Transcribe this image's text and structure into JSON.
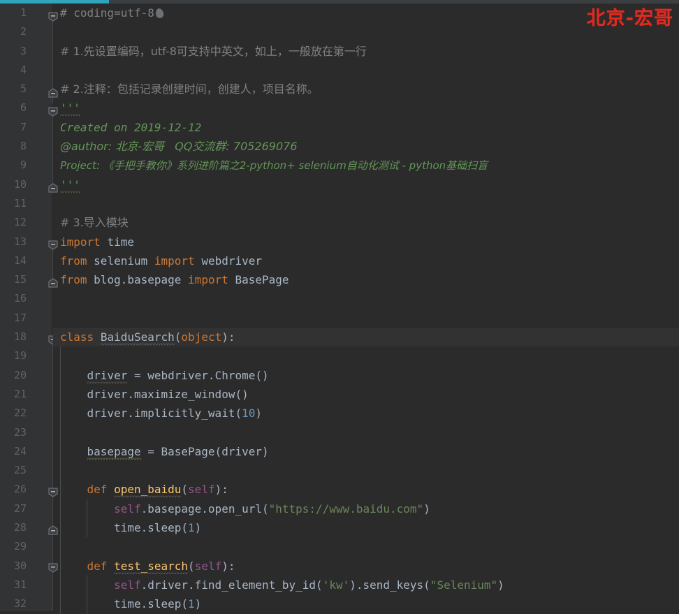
{
  "app": {
    "kind": "code-editor",
    "theme": "darcula",
    "background": "#2b2b2b",
    "highlight_line_bg": "#323232",
    "gutter_bg": "#313335"
  },
  "progress_bar": {
    "color": "#31a4bc",
    "track_color": "#3c3f41",
    "percent": 16
  },
  "watermark": {
    "text": "北京-宏哥",
    "color": "#e02b20"
  },
  "gutter": {
    "line_numbers": [
      1,
      2,
      3,
      4,
      5,
      6,
      7,
      8,
      9,
      10,
      11,
      12,
      13,
      14,
      15,
      16,
      17,
      18,
      19,
      20,
      21,
      22,
      23,
      24,
      25,
      26,
      27,
      28,
      29,
      30,
      31,
      32
    ],
    "fold_markers": [
      {
        "line": 1,
        "state": "expanded"
      },
      {
        "line": 5,
        "state": "collapsed-region"
      },
      {
        "line": 6,
        "state": "expanded"
      },
      {
        "line": 10,
        "state": "collapsed-region"
      },
      {
        "line": 13,
        "state": "expanded"
      },
      {
        "line": 15,
        "state": "collapsed-region"
      },
      {
        "line": 18,
        "state": "expanded"
      },
      {
        "line": 26,
        "state": "expanded"
      },
      {
        "line": 28,
        "state": "collapsed-region"
      },
      {
        "line": 30,
        "state": "expanded"
      }
    ]
  },
  "editor": {
    "highlighted_line": 18,
    "lines": [
      {
        "n": 1,
        "text": "# coding=utf-8"
      },
      {
        "n": 2,
        "text": ""
      },
      {
        "n": 3,
        "text": "# 1.先设置编码，utf-8可支持中英文，如上，一般放在第一行"
      },
      {
        "n": 4,
        "text": ""
      },
      {
        "n": 5,
        "text": "# 2.注释：包括记录创建时间，创建人，项目名称。"
      },
      {
        "n": 6,
        "text": "'''"
      },
      {
        "n": 7,
        "text": "Created on 2019-12-12"
      },
      {
        "n": 8,
        "text": "@author: 北京-宏哥   QQ交流群: 705269076"
      },
      {
        "n": 9,
        "text": "Project: 《手把手教你》系列进阶篇之2-python+ selenium自动化测试 - python基础扫盲"
      },
      {
        "n": 10,
        "text": "'''"
      },
      {
        "n": 11,
        "text": ""
      },
      {
        "n": 12,
        "text": "# 3.导入模块"
      },
      {
        "n": 13,
        "text": "import time"
      },
      {
        "n": 14,
        "text": "from selenium import webdriver"
      },
      {
        "n": 15,
        "text": "from blog.basepage import BasePage"
      },
      {
        "n": 16,
        "text": ""
      },
      {
        "n": 17,
        "text": ""
      },
      {
        "n": 18,
        "text": "class BaiduSearch(object):"
      },
      {
        "n": 19,
        "text": ""
      },
      {
        "n": 20,
        "text": "    driver = webdriver.Chrome()"
      },
      {
        "n": 21,
        "text": "    driver.maximize_window()"
      },
      {
        "n": 22,
        "text": "    driver.implicitly_wait(10)"
      },
      {
        "n": 23,
        "text": ""
      },
      {
        "n": 24,
        "text": "    basepage = BasePage(driver)"
      },
      {
        "n": 25,
        "text": ""
      },
      {
        "n": 26,
        "text": "    def open_baidu(self):"
      },
      {
        "n": 27,
        "text": "        self.basepage.open_url(\"https://www.baidu.com\")"
      },
      {
        "n": 28,
        "text": "        time.sleep(1)"
      },
      {
        "n": 29,
        "text": ""
      },
      {
        "n": 30,
        "text": "    def test_search(self):"
      },
      {
        "n": 31,
        "text": "        self.driver.find_element_by_id('kw').send_keys(\"Selenium\")"
      },
      {
        "n": 32,
        "text": "        time.sleep(1)"
      }
    ],
    "tokens": {
      "line1_comment": "# coding=utf-8",
      "line3_comment": "# 1.先设置编码，utf-8可支持中英文，如上，一般放在第一行",
      "line5_comment": "# 2.注释：包括记录创建时间，创建人，项目名称。",
      "docstring_open": "'''",
      "docstring_close": "'''",
      "doc_created": "Created on 2019-12-12",
      "doc_author": "@author: 北京-宏哥   QQ交流群: 705269076",
      "doc_project": "Project: 《手把手教你》系列进阶篇之2-python+ selenium自动化测试 - python基础扫盲",
      "line12_comment": "# 3.导入模块",
      "kw_import": "import",
      "kw_from": "from",
      "kw_class": "class",
      "kw_def": "def",
      "mod_time": "time",
      "mod_selenium": "selenium",
      "mod_webdriver": "webdriver",
      "mod_blog_basepage": "blog.basepage",
      "cls_BasePage": "BasePage",
      "cls_BaiduSearch": "BaiduSearch",
      "cls_object": "object",
      "var_driver": "driver",
      "expr_webdriver_chrome": "webdriver.Chrome()",
      "expr_maximize": "driver.maximize_window()",
      "expr_implicitly_wait_call": "driver.implicitly_wait(",
      "num_10": "10",
      "var_basepage": "basepage",
      "expr_basepage_assign": " = BasePage(driver)",
      "def_open_baidu": "open_baidu",
      "def_test_search": "test_search",
      "kw_self": "self",
      "expr_open_url": ".basepage.open_url(",
      "str_url": "\"https://www.baidu.com\"",
      "expr_time_sleep": "time.sleep(",
      "num_1": "1",
      "expr_find_element": ".driver.find_element_by_id(",
      "str_kw": "'kw'",
      "expr_send_keys": ").send_keys(",
      "str_selenium": "\"Selenium\""
    }
  }
}
